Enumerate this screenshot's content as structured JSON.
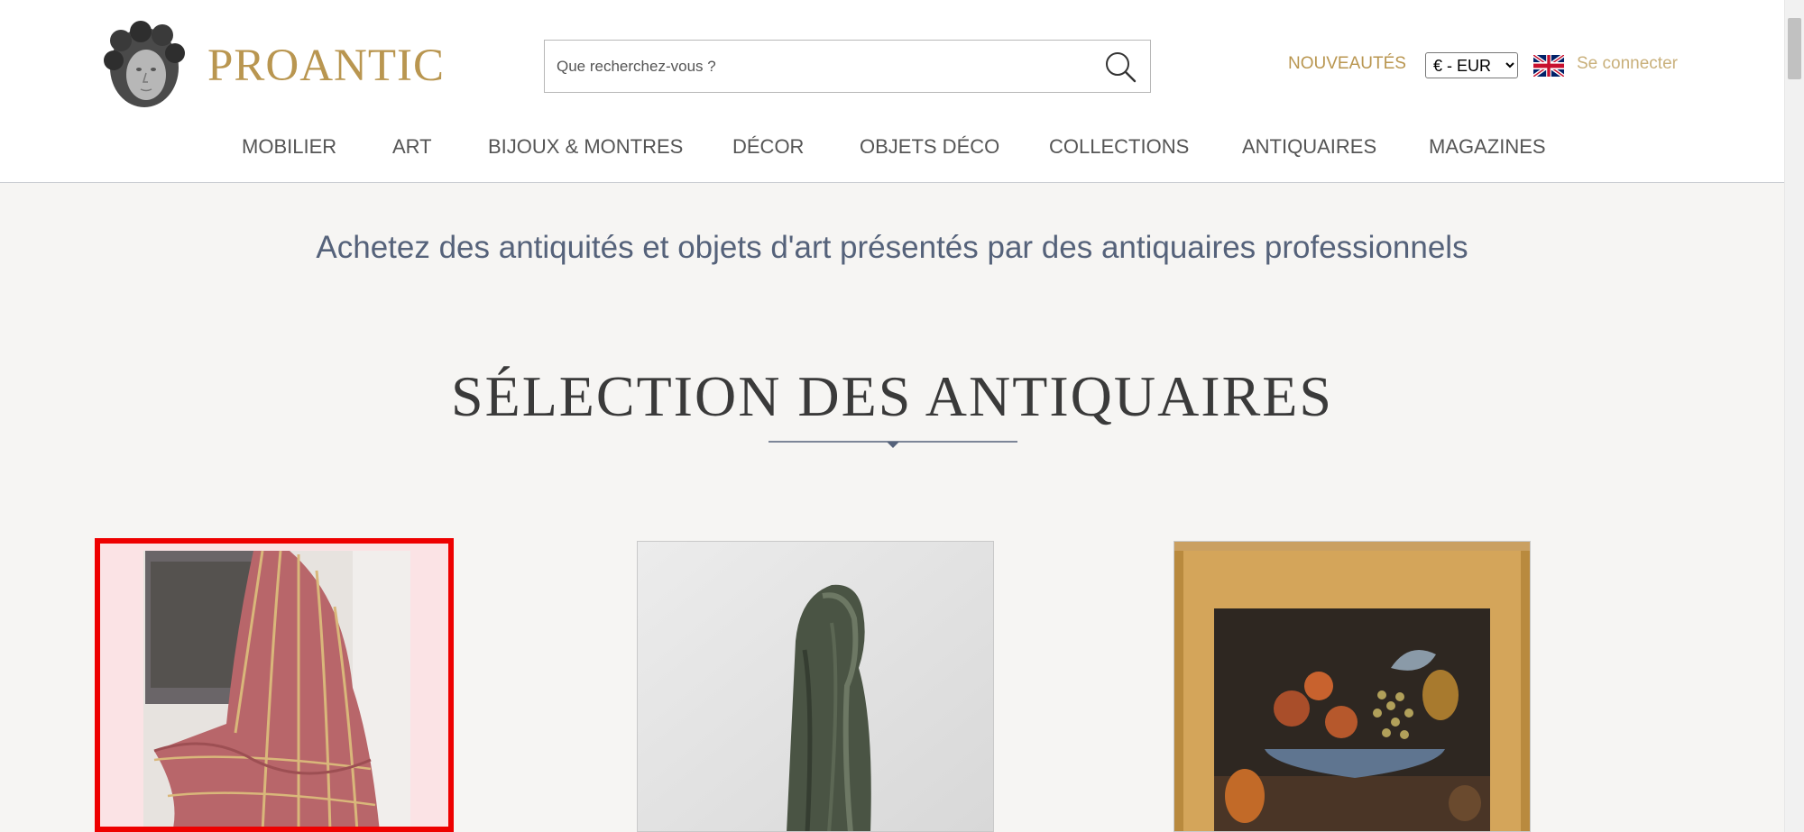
{
  "brand": {
    "name": "PROANTIC"
  },
  "search": {
    "placeholder": "Que recherchez-vous ?"
  },
  "header": {
    "new_label": "NOUVEAUTÉS",
    "currency_selected": "€ - EUR",
    "language_icon": "uk-flag-icon",
    "signin_label": "Se connecter"
  },
  "nav": {
    "items": [
      {
        "label": "MOBILIER"
      },
      {
        "label": "ART"
      },
      {
        "label": "BIJOUX & MONTRES"
      },
      {
        "label": "DÉCOR"
      },
      {
        "label": "OBJETS DÉCO"
      },
      {
        "label": "COLLECTIONS"
      },
      {
        "label": "ANTIQUAIRES"
      },
      {
        "label": "MAGAZINES"
      }
    ]
  },
  "main": {
    "tagline": "Achetez des antiquités et objets d'art présentés par des antiquaires professionnels",
    "section_title": "SÉLECTION DES ANTIQUAIRES"
  },
  "colors": {
    "brand_gold": "#b99650",
    "tagline_blue": "#55627a",
    "selection_red": "#ee0000",
    "page_bg": "#f6f5f3"
  }
}
